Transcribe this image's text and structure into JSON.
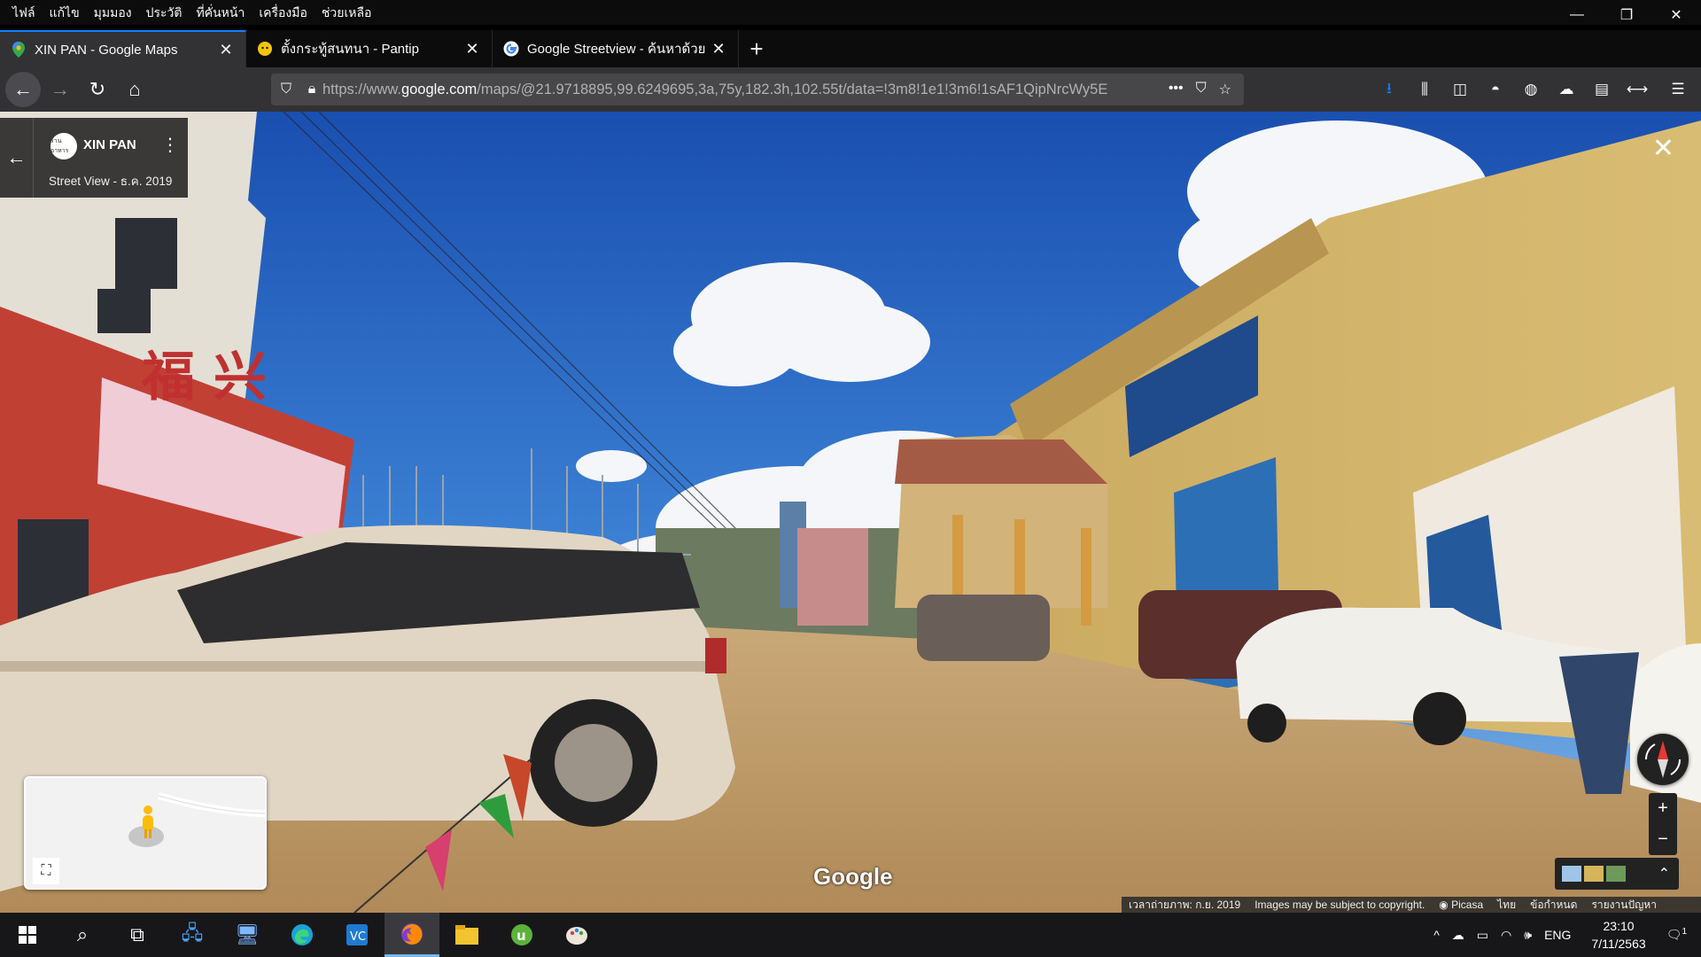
{
  "menubar": {
    "items": [
      "ไฟล์",
      "แก้ไข",
      "มุมมอง",
      "ประวัติ",
      "ที่คั่นหน้า",
      "เครื่องมือ",
      "ช่วยเหลือ"
    ]
  },
  "window": {
    "minimize": "—",
    "restore": "❐",
    "close": "✕"
  },
  "tabs": [
    {
      "title": "XIN PAN - Google Maps",
      "active": true
    },
    {
      "title": "ตั้งกระทู้สนทนา - Pantip",
      "active": false
    },
    {
      "title": "Google Streetview - ค้นหาด้วย G",
      "active": false
    }
  ],
  "new_tab": "+",
  "url": {
    "prefix": "https://www.",
    "domain": "google.com",
    "path": "/maps/@21.9718895,99.6249695,3a,75y,182.3h,102.55t/data=!3m8!1e1!3m6!1sAF1QipNrcWy5E"
  },
  "place": {
    "avatar_text": "ร้านอาหาร",
    "name": "XIN PAN",
    "subtitle": "Street View - ธ.ค. 2019"
  },
  "branding": "Google",
  "footer": {
    "capture_date": "เวลาถ่ายภาพ: ก.ย. 2019",
    "copyright": "Images may be subject to copyright.",
    "picasa": "Picasa",
    "language": "ไทย",
    "terms": "ข้อกำหนด",
    "report": "รายงานปัญหา"
  },
  "zoom": {
    "in": "+",
    "out": "−"
  },
  "taskbar": {
    "language": "ENG",
    "time": "23:10",
    "date": "7/11/2563",
    "notifications": "1"
  }
}
